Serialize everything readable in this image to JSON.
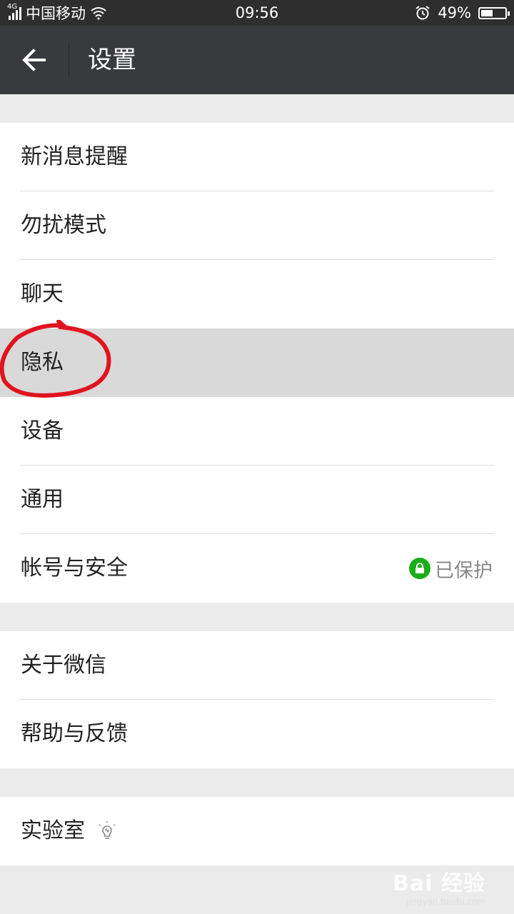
{
  "status_bar": {
    "network": "4G",
    "carrier": "中国移动",
    "time": "09:56",
    "battery_percent_text": "49%",
    "battery_level": 0.49,
    "icons": [
      "signal-icon",
      "wifi-icon",
      "alarm-icon",
      "battery-icon"
    ]
  },
  "header": {
    "title": "设置",
    "back_icon": "arrow-left-icon",
    "background": "#393a3e"
  },
  "settings_groups": [
    {
      "items": [
        {
          "label": "新消息提醒"
        },
        {
          "label": "勿扰模式"
        },
        {
          "label": "聊天"
        },
        {
          "label": "隐私",
          "highlighted": true
        },
        {
          "label": "设备"
        },
        {
          "label": "通用"
        },
        {
          "label": "帐号与安全",
          "status": "已保护",
          "status_icon": "lock-icon"
        }
      ]
    },
    {
      "items": [
        {
          "label": "关于微信"
        },
        {
          "label": "帮助与反馈"
        }
      ]
    },
    {
      "items": [
        {
          "label": "实验室",
          "icon": "lightbulb-icon"
        }
      ]
    }
  ],
  "colors": {
    "accent_green": "#1aad19",
    "annotation_red": "#e0141e",
    "page_bg": "#ebebeb"
  },
  "watermark": {
    "brand": "Bai 经验",
    "url": "jingyan.baidu.com"
  }
}
